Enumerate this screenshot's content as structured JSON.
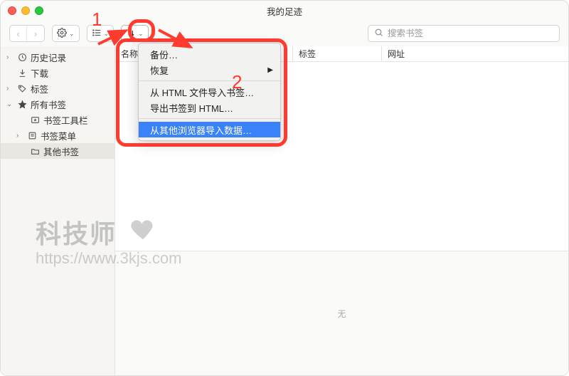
{
  "title": "我的足迹",
  "search": {
    "placeholder": "搜索书签"
  },
  "sidebar": {
    "items": [
      {
        "label": "历史记录"
      },
      {
        "label": "下载"
      },
      {
        "label": "标签"
      },
      {
        "label": "所有书签"
      },
      {
        "label": "书签工具栏"
      },
      {
        "label": "书签菜单"
      },
      {
        "label": "其他书签"
      }
    ]
  },
  "columns": {
    "name": "名称",
    "tag": "标签",
    "url": "网址"
  },
  "menu": {
    "backup": "备份…",
    "restore": "恢复",
    "import_html": "从 HTML 文件导入书签…",
    "export_html": "导出书签到 HTML…",
    "import_browser": "从其他浏览器导入数据…"
  },
  "bottom": {
    "none": "无"
  },
  "annotations": {
    "one": "1",
    "two": "2"
  },
  "watermark": {
    "line1": "科技师",
    "line2": "https://www.3kjs.com"
  }
}
